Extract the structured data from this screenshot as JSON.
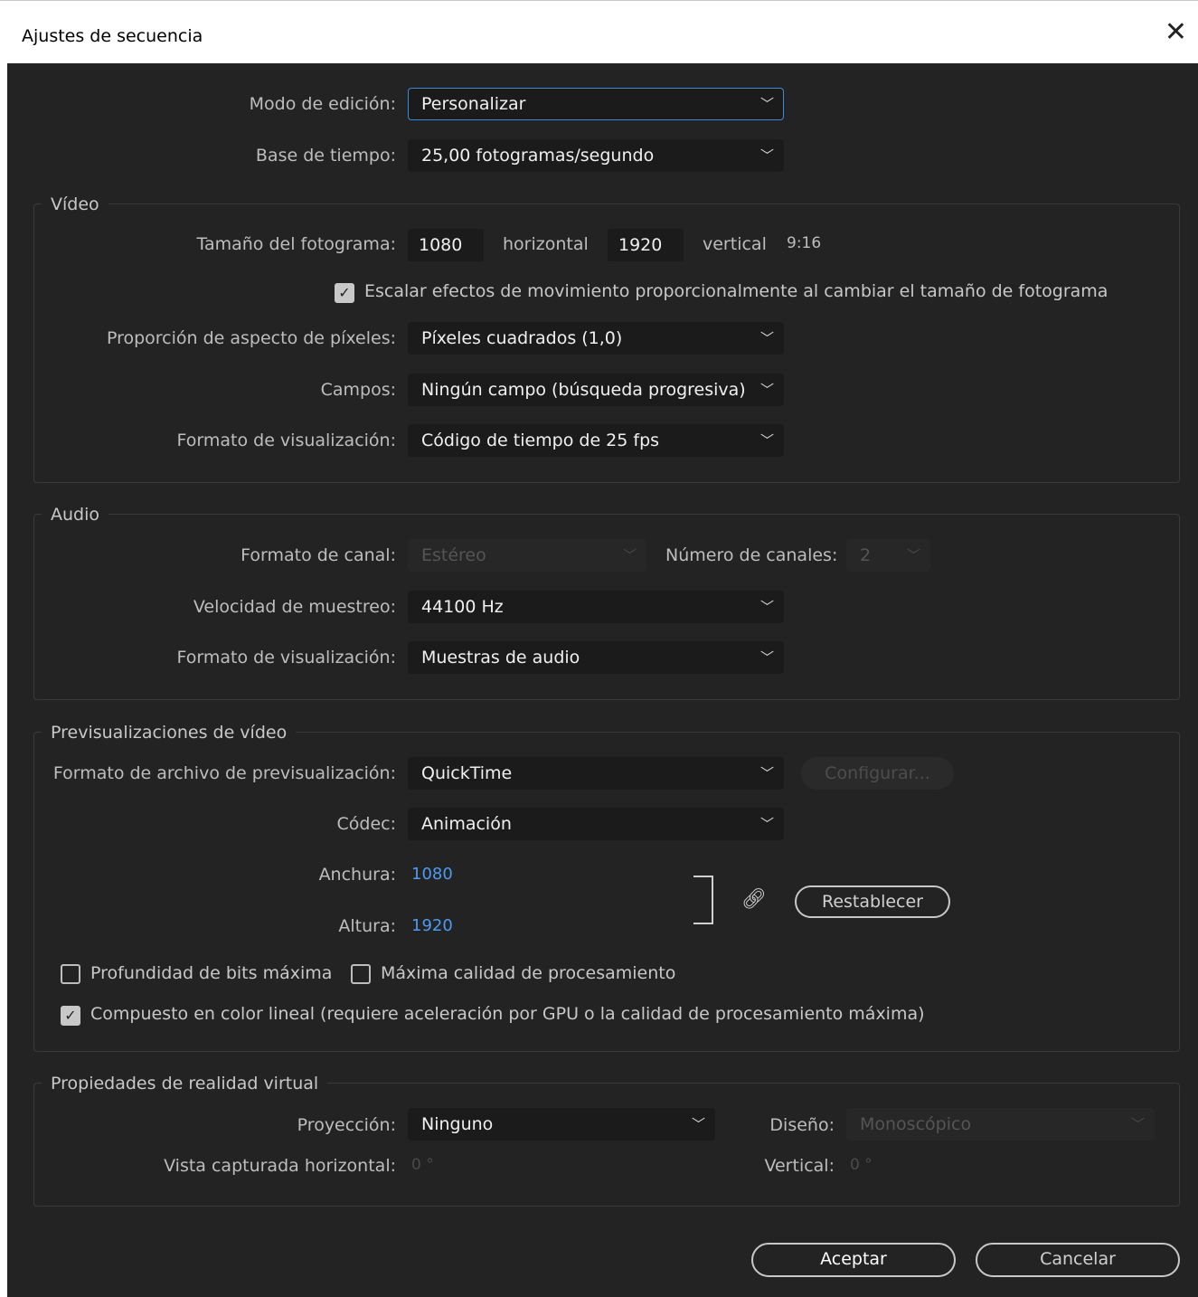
{
  "window": {
    "title": "Ajustes de secuencia",
    "close_icon": "close-icon"
  },
  "general": {
    "editing_mode": {
      "label": "Modo de edición:",
      "value": "Personalizar"
    },
    "timebase": {
      "label": "Base de tiempo:",
      "value": "25,00  fotogramas/segundo"
    }
  },
  "video": {
    "title": "Vídeo",
    "frame_size": {
      "label": "Tamaño del fotograma:",
      "width": "1080",
      "horizontal_label": "horizontal",
      "height": "1920",
      "vertical_label": "vertical",
      "ratio": "9:16"
    },
    "scale_effects": {
      "label": "Escalar efectos de movimiento proporcionalmente al cambiar el tamaño de fotograma",
      "checked": true
    },
    "pixel_aspect": {
      "label": "Proporción de aspecto de píxeles:",
      "value": "Píxeles cuadrados (1,0)"
    },
    "fields": {
      "label": "Campos:",
      "value": "Ningún campo (búsqueda progresiva)"
    },
    "display_format": {
      "label": "Formato de visualización:",
      "value": "Código de tiempo de 25 fps"
    }
  },
  "audio": {
    "title": "Audio",
    "channel_format": {
      "label": "Formato de canal:",
      "value": "Estéreo",
      "disabled": true
    },
    "num_channels": {
      "label": "Número de canales:",
      "value": "2",
      "disabled": true
    },
    "sample_rate": {
      "label": "Velocidad de muestreo:",
      "value": "44100 Hz"
    },
    "display_format": {
      "label": "Formato de visualización:",
      "value": "Muestras de audio"
    }
  },
  "previews": {
    "title": "Previsualizaciones de vídeo",
    "file_format": {
      "label": "Formato de archivo de previsualización:",
      "value": "QuickTime"
    },
    "configure_label": "Configurar...",
    "codec": {
      "label": "Códec:",
      "value": "Animación"
    },
    "width": {
      "label": "Anchura:",
      "value": "1080"
    },
    "height": {
      "label": "Altura:",
      "value": "1920"
    },
    "reset_label": "Restablecer",
    "max_bit_depth": {
      "label": "Profundidad de bits máxima",
      "checked": false
    },
    "max_render_quality": {
      "label": "Máxima calidad de procesamiento",
      "checked": false
    },
    "linear_color": {
      "label": "Compuesto en color lineal (requiere aceleración por GPU o la calidad de procesamiento máxima)",
      "checked": true
    }
  },
  "vr": {
    "title": "Propiedades de realidad virtual",
    "projection": {
      "label": "Proyección:",
      "value": "Ninguno"
    },
    "layout": {
      "label": "Diseño:",
      "value": "Monoscópico",
      "disabled": true
    },
    "captured_h": {
      "label": "Vista capturada horizontal:",
      "value": "0 °"
    },
    "vertical": {
      "label": "Vertical:",
      "value": "0 °"
    }
  },
  "footer": {
    "ok_label": "Aceptar",
    "cancel_label": "Cancelar"
  },
  "colors": {
    "accent": "#4c9bf0",
    "background": "#232323",
    "focus": "#3f88d6"
  }
}
